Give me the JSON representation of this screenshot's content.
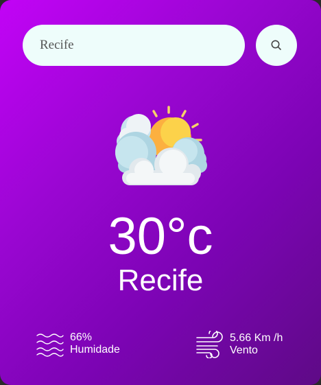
{
  "search": {
    "value": "Recife",
    "icon": "search-icon"
  },
  "weather": {
    "icon": "partly-cloudy-icon",
    "temperature": "30°c",
    "city": "Recife"
  },
  "details": {
    "humidity": {
      "icon": "humidity-waves-icon",
      "value": "66%",
      "label": "Humidade"
    },
    "wind": {
      "icon": "wind-icon",
      "value": "5.66 Km /h",
      "label": "Vento"
    }
  },
  "colors": {
    "gradient_start": "#c203f6",
    "gradient_end": "#5e0a86",
    "input_background": "#eefdfb",
    "text": "#ffffff"
  }
}
